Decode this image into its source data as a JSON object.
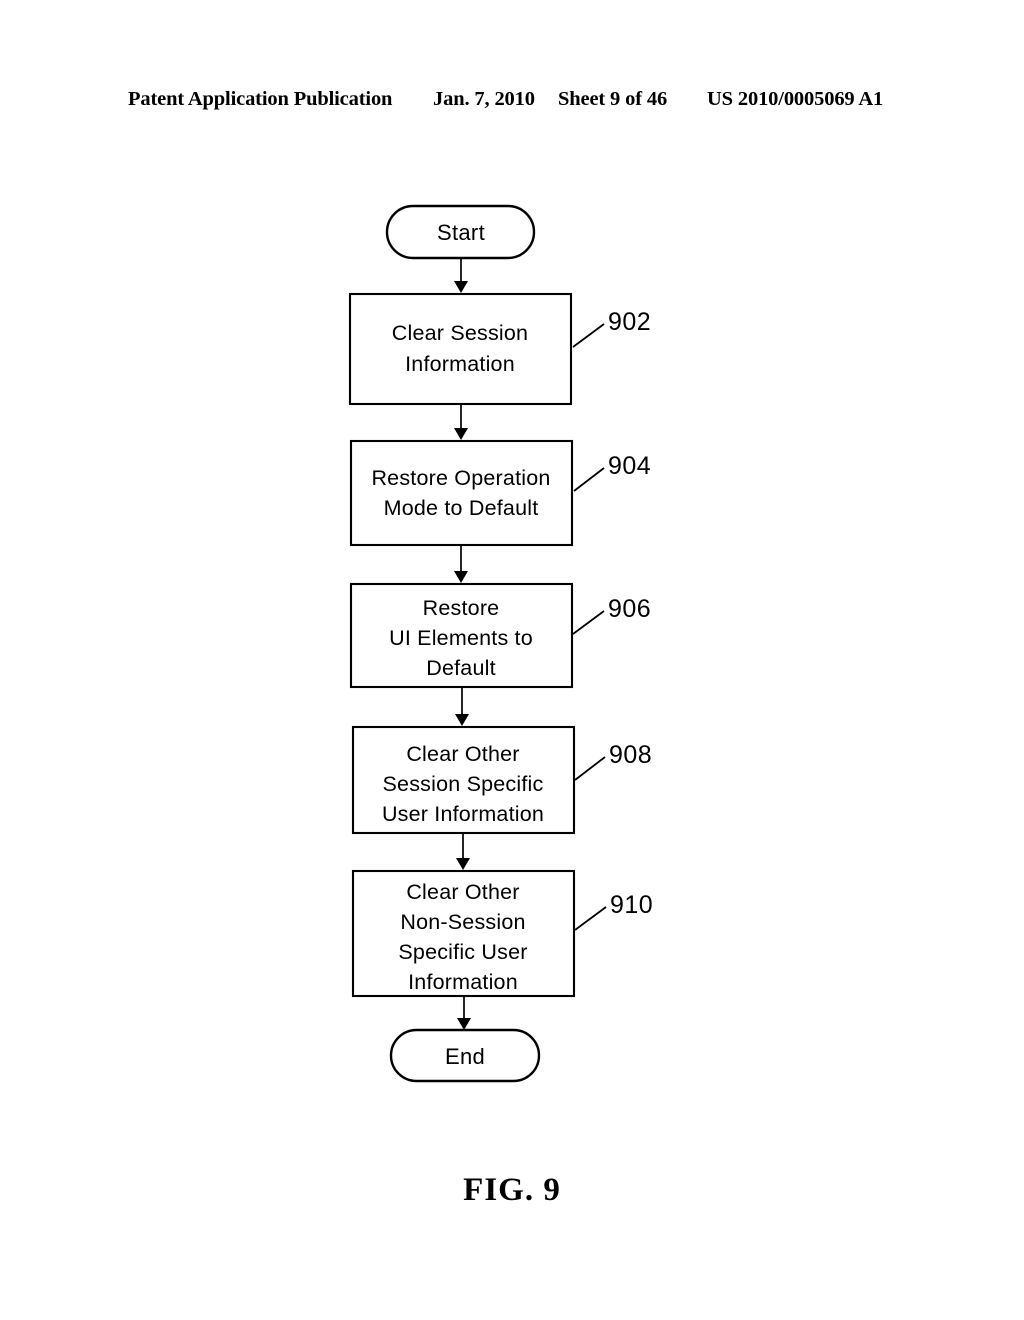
{
  "header": {
    "publication": "Patent Application Publication",
    "date": "Jan. 7, 2010",
    "sheet": "Sheet 9 of 46",
    "patent_number": "US 2010/0005069 A1"
  },
  "figure": {
    "caption": "FIG. 9",
    "start_label": "Start",
    "end_label": "End",
    "steps": [
      {
        "ref": "902",
        "lines": [
          "Clear Session",
          "Information"
        ]
      },
      {
        "ref": "904",
        "lines": [
          "Restore Operation",
          "Mode to Default"
        ]
      },
      {
        "ref": "906",
        "lines": [
          "Restore",
          "UI Elements to",
          "Default"
        ]
      },
      {
        "ref": "908",
        "lines": [
          "Clear Other",
          "Session Specific",
          "User Information"
        ]
      },
      {
        "ref": "910",
        "lines": [
          "Clear Other",
          "Non-Session",
          "Specific User",
          "Information"
        ]
      }
    ]
  },
  "colors": {
    "ink": "#000000",
    "paper": "#ffffff"
  }
}
